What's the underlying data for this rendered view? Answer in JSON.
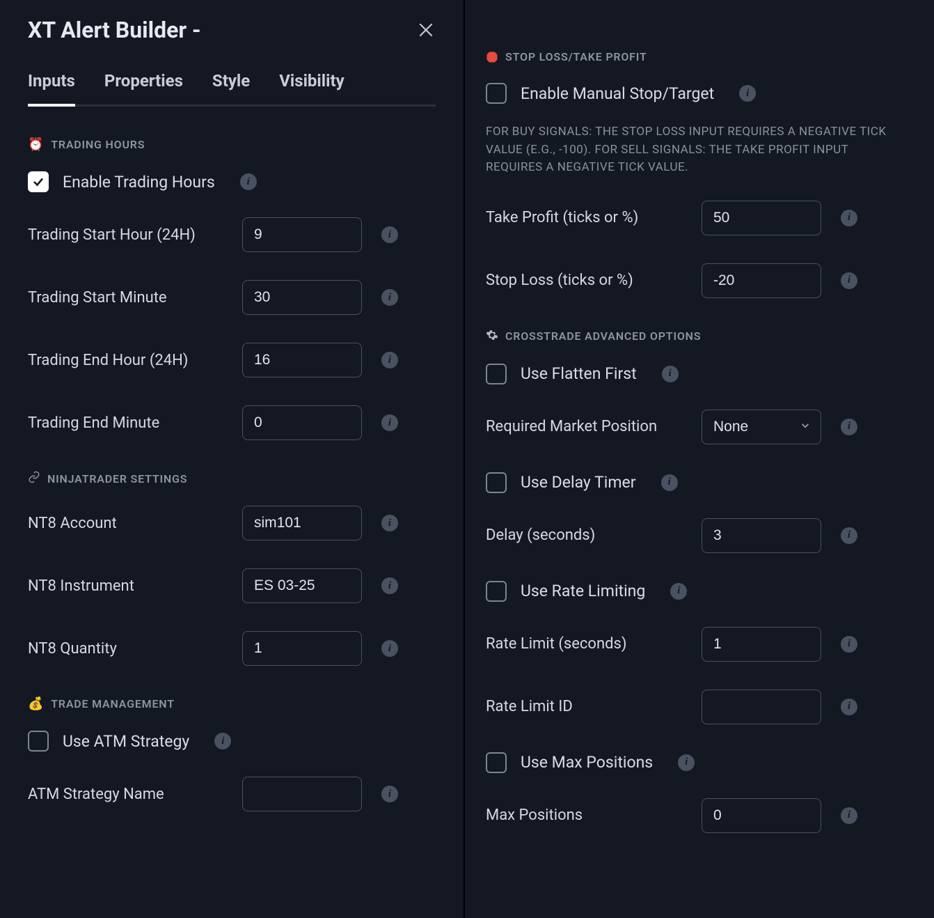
{
  "title": "XT Alert Builder -",
  "tabs": {
    "inputs": "Inputs",
    "properties": "Properties",
    "style": "Style",
    "visibility": "Visibility"
  },
  "sections": {
    "tradingHours": "TRADING HOURS",
    "ninjatrader": "NINJATRADER SETTINGS",
    "tradeMgmt": "TRADE MANAGEMENT",
    "stopLoss": "STOP LOSS/TAKE PROFIT",
    "crosstrade": "CROSSTRADE ADVANCED OPTIONS"
  },
  "labels": {
    "enableTradingHours": "Enable Trading Hours",
    "startHour": "Trading Start Hour (24H)",
    "startMin": "Trading Start Minute",
    "endHour": "Trading End Hour (24H)",
    "endMin": "Trading End Minute",
    "nt8Account": "NT8 Account",
    "nt8Instrument": "NT8 Instrument",
    "nt8Qty": "NT8 Quantity",
    "useATM": "Use ATM Strategy",
    "atmName": "ATM Strategy Name",
    "enableManualStop": "Enable Manual Stop/Target",
    "takeProfit": "Take Profit (ticks or %)",
    "stopLoss": "Stop Loss (ticks or %)",
    "flattenFirst": "Use Flatten First",
    "reqMarketPos": "Required Market Position",
    "useDelay": "Use Delay Timer",
    "delaySec": "Delay (seconds)",
    "useRateLimit": "Use Rate Limiting",
    "rateLimitSec": "Rate Limit (seconds)",
    "rateLimitId": "Rate Limit ID",
    "useMaxPos": "Use Max Positions",
    "maxPos": "Max Positions"
  },
  "values": {
    "startHour": "9",
    "startMin": "30",
    "endHour": "16",
    "endMin": "0",
    "nt8Account": "sim101",
    "nt8Instrument": "ES 03-25",
    "nt8Qty": "1",
    "atmName": "",
    "takeProfit": "50",
    "stopLoss": "-20",
    "reqMarketPos": "None",
    "delaySec": "3",
    "rateLimitSec": "1",
    "rateLimitId": "",
    "maxPos": "0"
  },
  "checks": {
    "enableTradingHours": true,
    "useATM": false,
    "enableManualStop": false,
    "flattenFirst": false,
    "useDelay": false,
    "useRateLimit": false,
    "useMaxPos": false
  },
  "hint": "FOR BUY SIGNALS: THE STOP LOSS INPUT REQUIRES A NEGATIVE TICK VALUE (E.G., -100). FOR SELL SIGNALS: THE TAKE PROFIT INPUT REQUIRES A NEGATIVE TICK VALUE.",
  "icons": {
    "clock": "⏰",
    "bag": "💰"
  }
}
